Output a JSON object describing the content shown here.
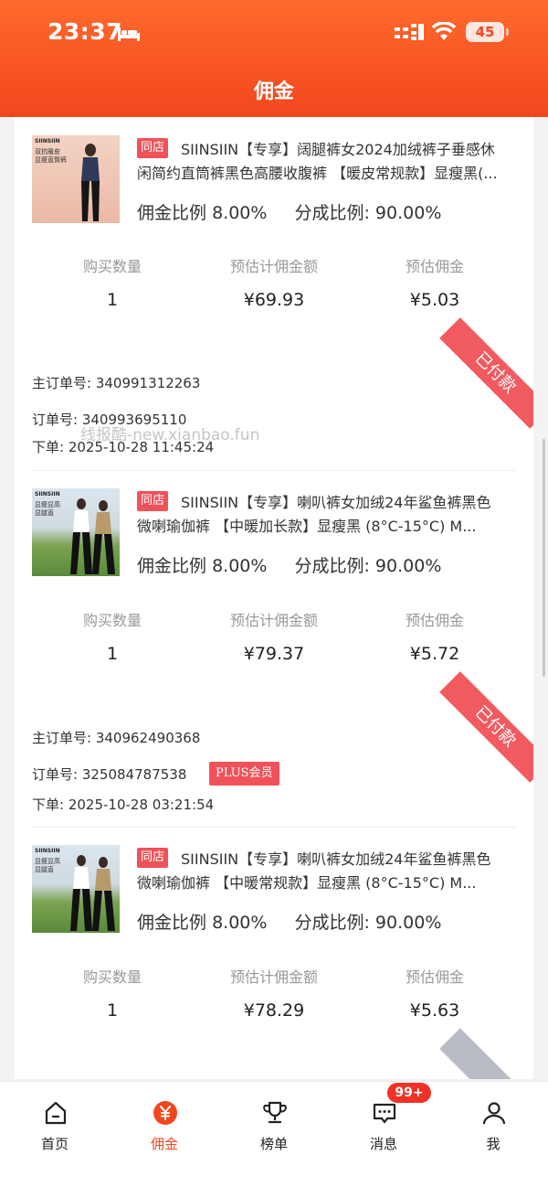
{
  "status_bar": {
    "time": "23:37",
    "battery": "45"
  },
  "header": {
    "title": "佣金"
  },
  "labels": {
    "store_tag": "同店",
    "commission_rate_label": "佣金比例",
    "share_rate_label": "分成比例:",
    "qty_label": "购买数量",
    "est_amount_label": "预估计佣金额",
    "est_commission_label": "预估佣金",
    "main_order_label": "主订单号:",
    "order_label": "订单号:",
    "order_time_label": "下单:",
    "paid_label": "已付款"
  },
  "watermark": "线报酷-new.xianbao.fun",
  "items": [
    {
      "thumb_brand": "SIINSIIN",
      "thumb_caption_1": "双抗暖皮",
      "thumb_caption_2": "显瘦直筒裤",
      "title_line1": "SIINSIIN【专享】阔腿裤女2024加绒裤子垂感休",
      "title_line2": "闲简约直筒裤黑色高腰收腹裤 【暖皮常规款】显瘦黑(...",
      "commission_rate": "8.00%",
      "share_rate": "90.00%",
      "qty": "1",
      "est_amount": "¥69.93",
      "est_commission": "¥5.03",
      "main_order_no": "340991312263",
      "order_no": "340993695110",
      "order_time": "2025-10-28 11:45:24",
      "status": "已付款"
    },
    {
      "thumb_brand": "SIINSIIN",
      "thumb_caption_1": "显瘦显高",
      "thumb_caption_2": "显腿直",
      "title_line1": "SIINSIIN【专享】喇叭裤女加绒24年鲨鱼裤黑色",
      "title_line2": "微喇瑜伽裤 【中暖加长款】显瘦黑 (8°C-15°C) M...",
      "commission_rate": "8.00%",
      "share_rate": "90.00%",
      "qty": "1",
      "est_amount": "¥79.37",
      "est_commission": "¥5.72",
      "main_order_no": "340962490368",
      "order_no": "325084787538",
      "plus_badge": "PLUS会员",
      "order_time": "2025-10-28 03:21:54",
      "status": "已付款"
    },
    {
      "thumb_brand": "SIINSIIN",
      "thumb_caption_1": "显瘦显高",
      "thumb_caption_2": "显腿直",
      "title_line1": "SIINSIIN【专享】喇叭裤女加绒24年鲨鱼裤黑色",
      "title_line2": "微喇瑜伽裤 【中暖常规款】显瘦黑 (8°C-15°C) M...",
      "commission_rate": "8.00%",
      "share_rate": "90.00%",
      "qty": "1",
      "est_amount": "¥78.29",
      "est_commission": "¥5.63"
    }
  ],
  "tabbar": {
    "home": "首页",
    "commission": "佣金",
    "ranking": "榜单",
    "messages": "消息",
    "messages_badge": "99+",
    "me": "我"
  },
  "colors": {
    "brand": "#f2461e",
    "tag": "#f0525a",
    "ribbon_paid": "#f15a5f"
  }
}
